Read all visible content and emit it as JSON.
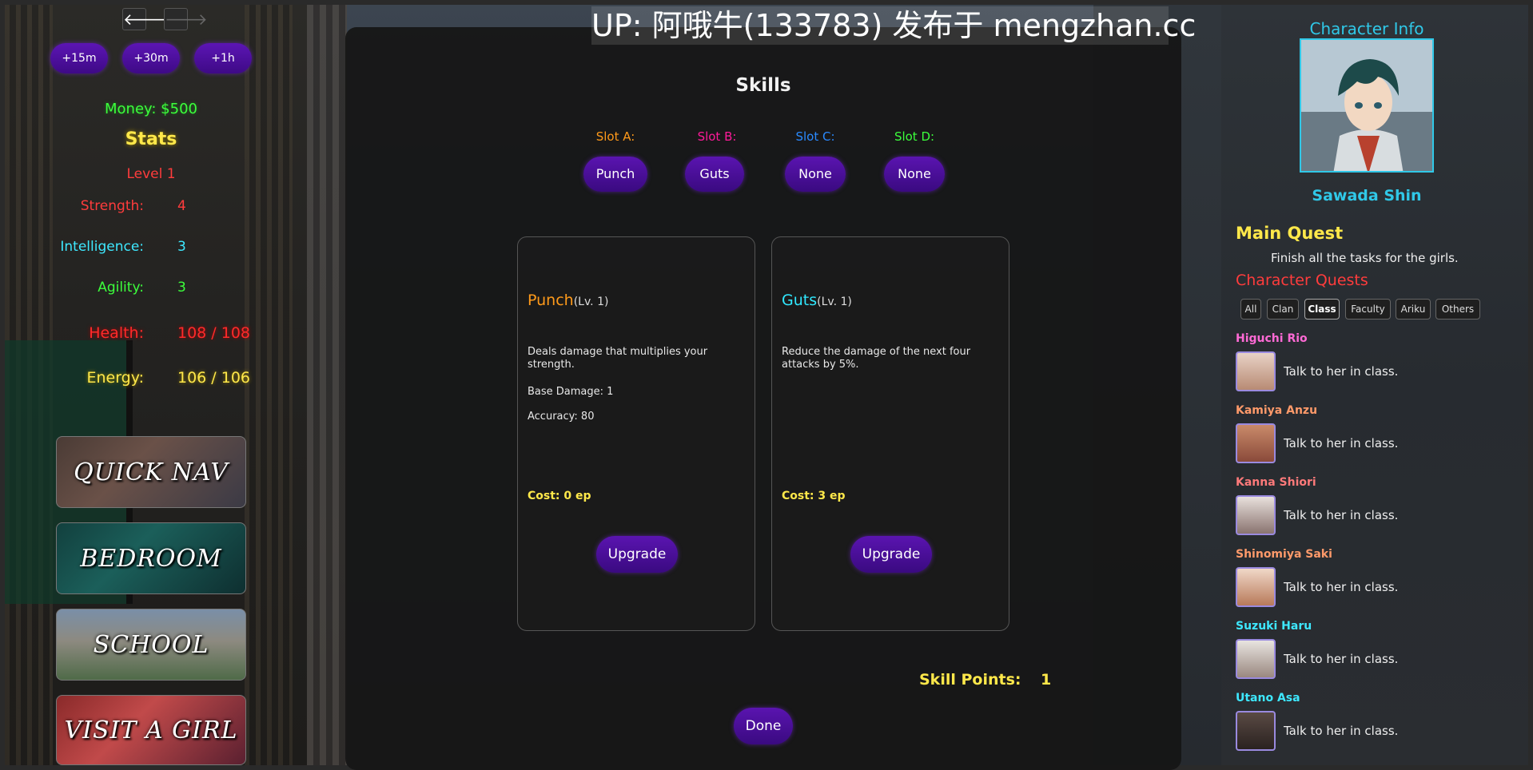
{
  "watermark": "UP: 阿哦牛(133783) 发布于 mengzhan.cc",
  "nav": {
    "back_icon": "🡐",
    "forward_icon": "🡒"
  },
  "time_buttons": [
    "+15m",
    "+30m",
    "+1h"
  ],
  "money": "Money: $500",
  "stats": {
    "title": "Stats",
    "level": "Level 1",
    "rows": [
      {
        "label": "Strength:",
        "value": "4",
        "color": "#ff3c3c"
      },
      {
        "label": "Intelligence:",
        "value": "3",
        "color": "#3ee8ff"
      },
      {
        "label": "Agility:",
        "value": "3",
        "color": "#3cff3c"
      },
      {
        "label": "Health:",
        "value": "108 / 108",
        "color": "#ff2a2a"
      },
      {
        "label": "Energy:",
        "value": "106 / 106",
        "color": "#ffe84a"
      }
    ]
  },
  "nav_cards": [
    "QUICK NAV",
    "BEDROOM",
    "SCHOOL",
    "VISIT A GIRL"
  ],
  "skills": {
    "title": "Skills",
    "slots": [
      {
        "label": "Slot A:",
        "value": "Punch",
        "color": "#ff9a1a"
      },
      {
        "label": "Slot B:",
        "value": "Guts",
        "color": "#ff1a9a"
      },
      {
        "label": "Slot C:",
        "value": "None",
        "color": "#2a8aff"
      },
      {
        "label": "Slot D:",
        "value": "None",
        "color": "#3cff3c"
      }
    ],
    "cards": [
      {
        "name": "Punch",
        "name_color": "#ff9a1a",
        "level": "(Lv. 1)",
        "description": "Deals damage that multiplies your strength.",
        "line1": "Base Damage: 1",
        "line2": "Accuracy: 80",
        "cost": "Cost: 0 ep",
        "button": "Upgrade"
      },
      {
        "name": "Guts",
        "name_color": "#30e8ff",
        "level": "(Lv. 1)",
        "description": "Reduce the damage of the next four attacks by 5%.",
        "line1": "",
        "line2": "",
        "cost": "Cost: 3 ep",
        "button": "Upgrade"
      }
    ],
    "skill_points_label": "Skill Points:",
    "skill_points_value": "1",
    "done": "Done"
  },
  "character": {
    "title": "Character Info",
    "name": "Sawada Shin",
    "main_quest_title": "Main Quest",
    "main_quest_text": "Finish all the tasks for the girls.",
    "char_quests_title": "Character Quests",
    "filters": [
      "All",
      "Clan",
      "Class",
      "Faculty",
      "Ariku",
      "Others"
    ],
    "active_filter": "Class",
    "quests": [
      {
        "name": "Higuchi Rio",
        "color": "#ff6ad5",
        "text": "Talk to her in class."
      },
      {
        "name": "Kamiya Anzu",
        "color": "#ff9a6a",
        "text": "Talk to her in class."
      },
      {
        "name": "Kanna Shiori",
        "color": "#ff7a7a",
        "text": "Talk to her in class."
      },
      {
        "name": "Shinomiya Saki",
        "color": "#ff9a6a",
        "text": "Talk to her in class."
      },
      {
        "name": "Suzuki Haru",
        "color": "#3ee8ff",
        "text": "Talk to her in class."
      },
      {
        "name": "Utano Asa",
        "color": "#3ee8ff",
        "text": "Talk to her in class."
      }
    ]
  }
}
